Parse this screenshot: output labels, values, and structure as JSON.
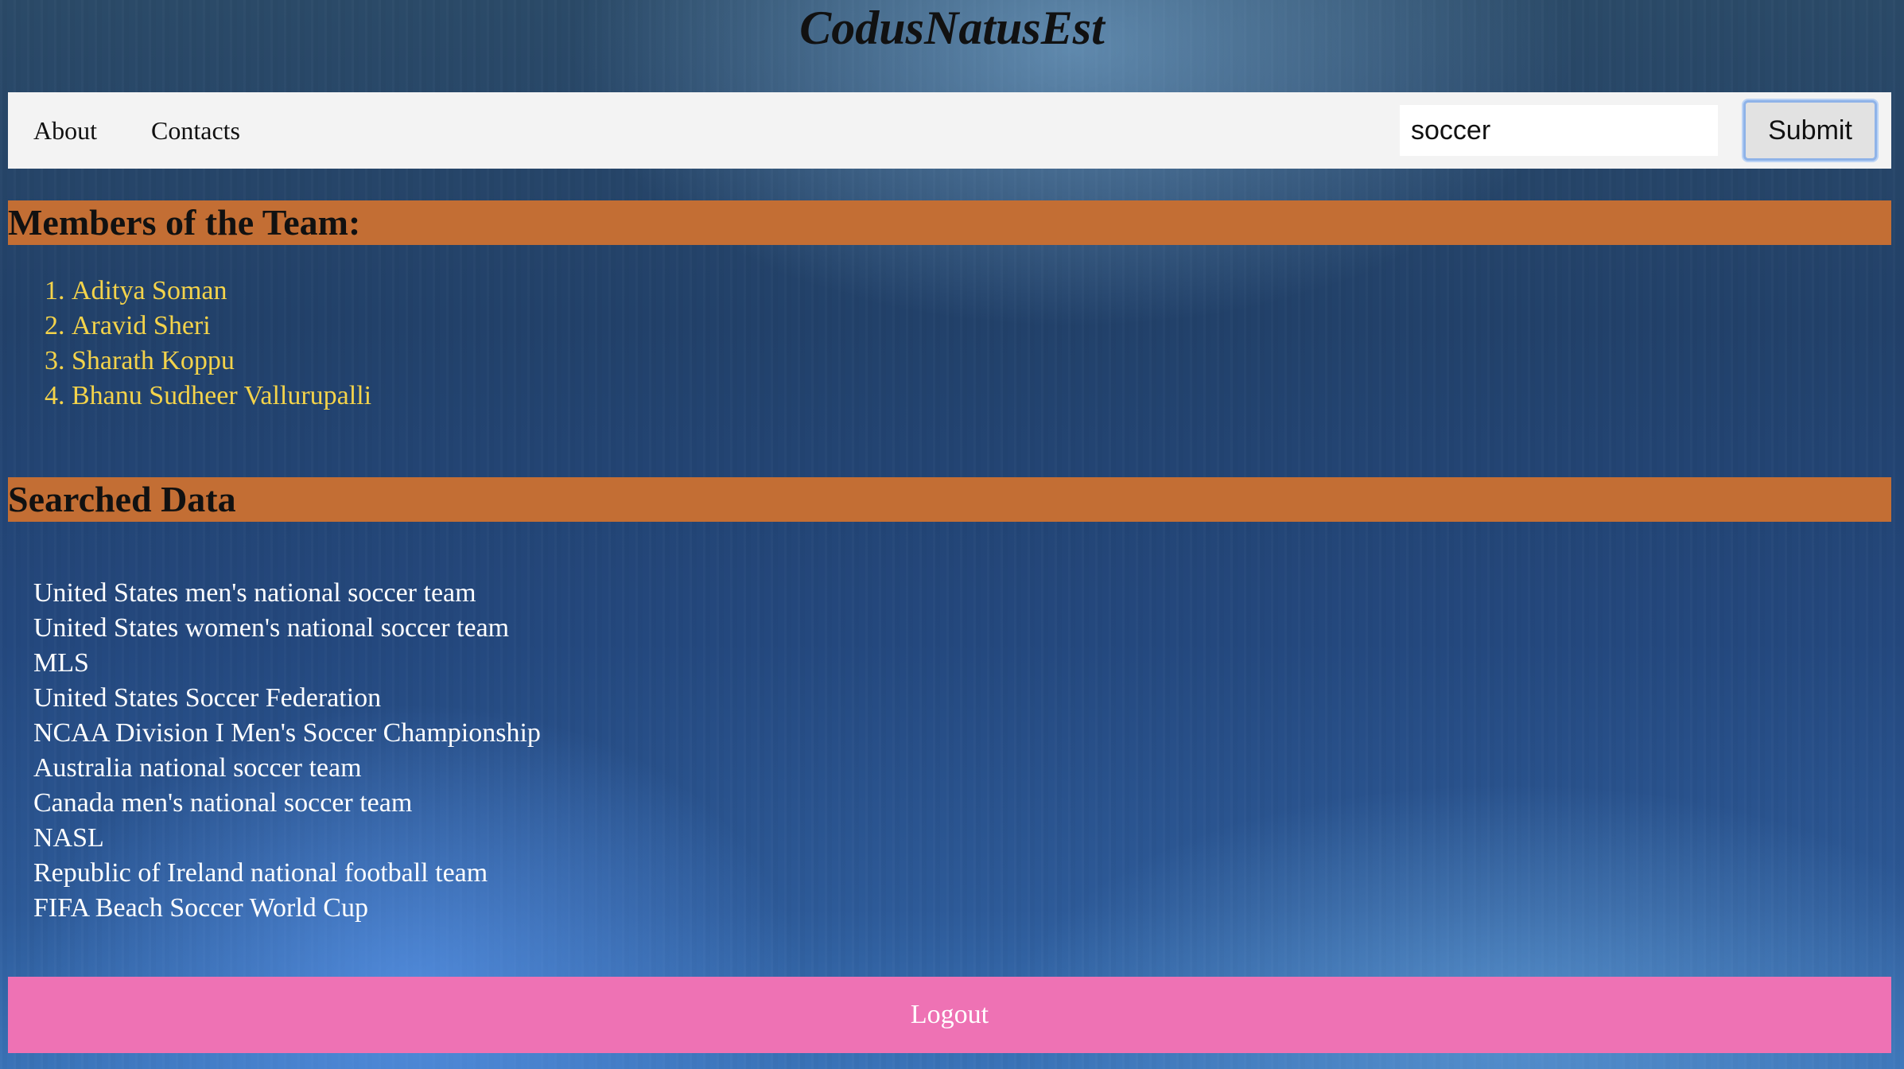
{
  "header": {
    "site_title": "CodusNatusEst"
  },
  "nav": {
    "links": [
      {
        "label": "About"
      },
      {
        "label": "Contacts"
      }
    ],
    "search": {
      "value": "soccer"
    },
    "submit_label": "Submit"
  },
  "members": {
    "heading": "Members of the Team:",
    "items": [
      "Aditya Soman",
      "Aravid Sheri",
      "Sharath Koppu",
      "Bhanu Sudheer Vallurupalli"
    ]
  },
  "search_results": {
    "heading": "Searched Data",
    "items": [
      "United States men's national soccer team",
      "United States women's national soccer team",
      "MLS",
      "United States Soccer Federation",
      "NCAA Division I Men's Soccer Championship",
      "Australia national soccer team",
      "Canada men's national soccer team",
      "NASL",
      "Republic of Ireland national football team",
      "FIFA Beach Soccer World Cup"
    ]
  },
  "footer": {
    "logout_label": "Logout"
  },
  "colors": {
    "section_header_bg": "#c36e34",
    "member_text": "#f4d34a",
    "logout_bg": "#ee72b4",
    "navbar_bg": "#f3f3f3"
  }
}
